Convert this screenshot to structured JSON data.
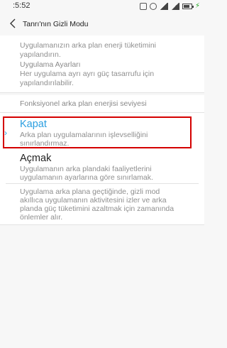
{
  "status_bar": {
    "time": ":5:52",
    "icons": [
      "sync-icon",
      "alarm-icon",
      "signal-icon",
      "wifi-icon",
      "battery-icon",
      "charging-icon"
    ]
  },
  "header": {
    "title": "Tanrı'nın Gizli Modu",
    "back_icon": "chevron-left-icon"
  },
  "intro": {
    "line1": "Uygulamanızın arka plan enerji tüketimini",
    "line2": "yapılandırın."
  },
  "app_settings": {
    "title": "Uygulama Ayarları",
    "desc_line1": "Her uygulama ayrı ayrı güç tasarrufu için",
    "desc_line2": "yapılandırılabilir."
  },
  "functional_section": {
    "label": "Fonksiyonel arka plan enerjisi seviyesi"
  },
  "options": [
    {
      "title": "Kapat",
      "desc_line1": "Arka plan uygulamalarının işlevselliğini",
      "desc_line2": "sınırlandırmaz.",
      "selected": true
    },
    {
      "title": "Açmak",
      "desc_line1": "Uygulamanın arka plandaki faaliyetlerini",
      "desc_line2": "uygulamanın ayarlarına göre sınırlamak.",
      "selected": false
    }
  ],
  "footer_note": {
    "line1": "Uygulama arka plana geçtiğinde, gizli mod",
    "line2": "akıllıca uygulamanın aktivitesini izler ve arka",
    "line3": "planda güç tüketimini azaltmak için zamanında",
    "line4": "önlemler alır."
  },
  "colors": {
    "accent": "#2a9ee0",
    "highlight": "#d40000",
    "background": "#f7f7f7"
  }
}
